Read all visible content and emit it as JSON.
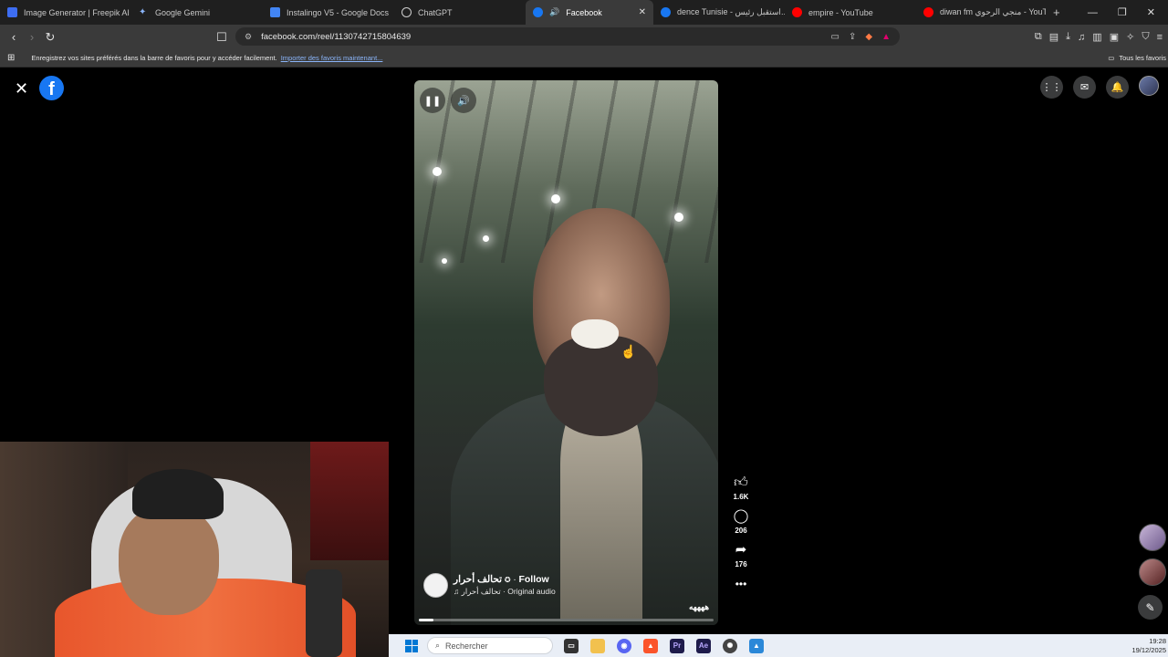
{
  "browser": {
    "tabs": [
      {
        "title": "Image Generator | Freepik AI",
        "fav_color": "#3d6df2",
        "active": false
      },
      {
        "title": "Google Gemini",
        "fav_color": "#8ab4f8",
        "active": false
      },
      {
        "title": "Instalingo V5 - Google Docs",
        "fav_color": "#4285f4",
        "active": false
      },
      {
        "title": "ChatGPT",
        "fav_color": "#cfcfcf",
        "active": false
      },
      {
        "title": "Facebook",
        "fav_color": "#1877f2",
        "active": true
      },
      {
        "title": "dence Tunisie - استقبل رئيس...",
        "fav_color": "#1877f2",
        "active": false
      },
      {
        "title": "empire - YouTube",
        "fav_color": "#ff0000",
        "active": false
      },
      {
        "title": "diwan fm منجي الرحوي - YouTu",
        "fav_color": "#ff0000",
        "active": false
      }
    ],
    "new_tab": "+",
    "url": "facebook.com/reel/1130742715804639",
    "bookmarks_bar": {
      "message": "Enregistrez vos sites préférés dans la barre de favoris pour y accéder facilement.",
      "link": "Importer des favoris maintenant...",
      "all_favorites": "Tous les favoris"
    }
  },
  "reel": {
    "page_name": "تحالف أحرار",
    "follow": "Follow",
    "audio": "تحالف أحرار · Original audio",
    "caption": "ههههه",
    "progress": 0.05,
    "likes": "1.6K",
    "comments": "206",
    "shares": "176"
  },
  "taskbar": {
    "search_placeholder": "Rechercher",
    "time": "19:28",
    "date": "19/12/2025"
  },
  "colors": {
    "facebook_blue": "#1877f2",
    "tab_bg": "#1f1f1f",
    "toolbar_bg": "#3a3a3a"
  }
}
